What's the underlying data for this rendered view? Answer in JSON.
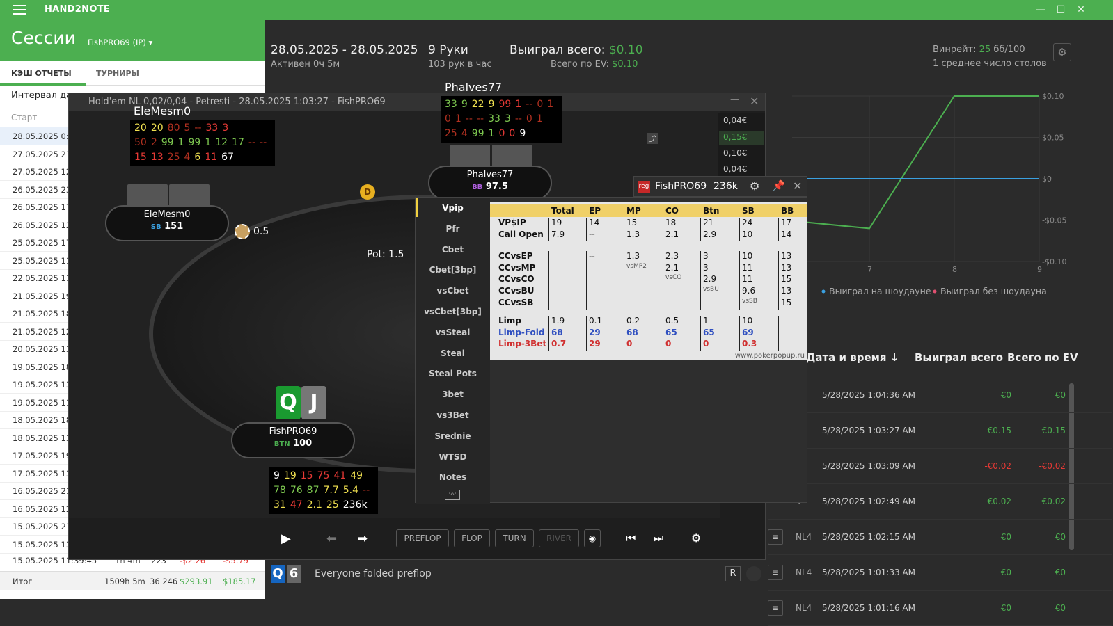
{
  "titlebar": {
    "app": "HAND2NOTE"
  },
  "header": {
    "title": "Сессии",
    "player": "FishPRO69 (IP)"
  },
  "tabs": {
    "cash": "КЭШ ОТЧЕТЫ",
    "tourn": "ТУРНИРЫ"
  },
  "left": {
    "interval": "Интервал да",
    "start": "Старт",
    "rows": [
      "28.05.2025 0:",
      "27.05.2025 21",
      "27.05.2025 12",
      "26.05.2025 23",
      "26.05.2025 17",
      "26.05.2025 12",
      "25.05.2025 17",
      "25.05.2025 11",
      "22.05.2025 11",
      "21.05.2025 19",
      "21.05.2025 18",
      "21.05.2025 12",
      "20.05.2025 13",
      "19.05.2025 18",
      "19.05.2025 13",
      "19.05.2025 11",
      "18.05.2025 18",
      "18.05.2025 13",
      "17.05.2025 19",
      "17.05.2025 13",
      "16.05.2025 21",
      "16.05.2025 12",
      "15.05.2025 21",
      "15.05.2025 13"
    ],
    "lastrow": {
      "date": "15.05.2025 11:39:45",
      "dur": "1h 4m",
      "hands": "223",
      "w": "-$2.26",
      "ev": "-$5.79"
    },
    "total": {
      "label": "Итог",
      "dur": "1509h 5m",
      "hands": "36 246",
      "w": "$293.91",
      "ev": "$185.17"
    }
  },
  "summary": {
    "dates": "28.05.2025 - 28.05.2025",
    "active": "Активен 0ч 5м",
    "hands": "9 Руки",
    "rate": "103 рук в час",
    "won_label": "Выиграл всего:",
    "won": "$0.10",
    "ev_label": "Всего по EV:",
    "ev": "$0.10",
    "winrate_label": "Винрейт:",
    "winrate_val": "25",
    "winrate_unit": "бб/100",
    "tables": "1 среднее число столов"
  },
  "chart_data": {
    "type": "line",
    "y_ticks": [
      "$0.10",
      "$0.05",
      "$0",
      "-$0.05",
      "-$0.10"
    ],
    "x_ticks": [
      "7",
      "8",
      "9"
    ],
    "legend": [
      "Выиграл на шоудауне",
      "Выиграл без шоудауна"
    ],
    "ylim": [
      -0.1,
      0.1
    ],
    "series": [
      {
        "name": "",
        "color": "#4caf50",
        "x": [
          6.0,
          7.0,
          8.0,
          9.0
        ],
        "y": [
          -0.05,
          -0.06,
          0.1,
          0.1
        ]
      },
      {
        "name": "",
        "color": "#3aa0e0",
        "x": [
          6.0,
          9.0
        ],
        "y": [
          0,
          0
        ]
      }
    ]
  },
  "table": {
    "headers": {
      "dt": "Дата и время",
      "won": "Выиграл всего",
      "ev": "Всего по EV"
    },
    "rows": [
      {
        "lim": "4",
        "dt": "5/28/2025 1:04:36 AM",
        "w": "€0",
        "ev": "€0",
        "c": "green"
      },
      {
        "lim": "4",
        "dt": "5/28/2025 1:03:27 AM",
        "w": "€0.15",
        "ev": "€0.15",
        "c": "green"
      },
      {
        "lim": "4",
        "dt": "5/28/2025 1:03:09 AM",
        "w": "-€0.02",
        "ev": "-€0.02",
        "c": "red"
      },
      {
        "lim": "4",
        "dt": "5/28/2025 1:02:49 AM",
        "w": "€0.02",
        "ev": "€0.02",
        "c": "green"
      },
      {
        "lim": "NL4",
        "dt": "5/28/2025 1:02:15 AM",
        "w": "€0",
        "ev": "€0",
        "c": "green"
      },
      {
        "lim": "NL4",
        "dt": "5/28/2025 1:01:33 AM",
        "w": "€0",
        "ev": "€0",
        "c": "green"
      },
      {
        "lim": "NL4",
        "dt": "5/28/2025 1:01:16 AM",
        "w": "€0",
        "ev": "€0",
        "c": "green"
      }
    ]
  },
  "replayer": {
    "title": "Hold'em NL 0,02/0,04 - Petresti - 28.05.2025 1:03:27 - FishPRO69",
    "pot": "Pot:  1.5",
    "bet_sb": "0.5",
    "bet_list": [
      "0,04€",
      "0,15€",
      "0,10€",
      "0,04€"
    ],
    "p1": {
      "name": "EleMesm0",
      "pos": "SB",
      "stack": "151"
    },
    "p2": {
      "name": "Phalves77",
      "pos": "BB",
      "stack": "97.5"
    },
    "p3": {
      "name": "FishPRO69",
      "pos": "BTN",
      "stack": "100"
    },
    "cards": [
      "Q",
      "J"
    ],
    "buttons": [
      "PREFLOP",
      "FLOP",
      "TURN",
      "RIVER"
    ],
    "bottom_text": "Everyone folded preflop",
    "bottom_cards": [
      "Q",
      "6"
    ],
    "r_label": "R",
    "dealer": "D"
  },
  "hud1": {
    "r1": [
      "20",
      "20",
      "80",
      "5",
      "--",
      "33",
      "3"
    ],
    "r2": [
      "50",
      "2",
      "99",
      "1",
      "99",
      "1",
      "12",
      "17",
      "--",
      "--"
    ],
    "r3": [
      "15",
      "13",
      "25",
      "4",
      "6",
      "11",
      "67"
    ]
  },
  "hud2": {
    "r1": [
      "33",
      "9",
      "22",
      "9",
      "99",
      "1",
      "--",
      "0",
      "1"
    ],
    "r2": [
      "0",
      "1",
      "--",
      "--",
      "33",
      "3",
      "--",
      "0",
      "1"
    ],
    "r3": [
      "25",
      "4",
      "99",
      "1",
      "0",
      "0",
      "9"
    ]
  },
  "hud3": {
    "r1": [
      "9",
      "19",
      "15",
      "75",
      "41",
      "49"
    ],
    "r2": [
      "78",
      "76",
      "87",
      "7.7",
      "5.4",
      "--"
    ],
    "r3": [
      "31",
      "47",
      "2.1",
      "25",
      "236k"
    ]
  },
  "popup": {
    "tag": "reg",
    "name": "FishPRO69",
    "hands": "236k",
    "menu": [
      "Vpip",
      "Pfr",
      "Cbet",
      "Cbet[3bp]",
      "vsCbet",
      "vsCbet[3bp]",
      "vsSteal",
      "Steal",
      "Steal Pots",
      "3bet",
      "vs3Bet",
      "Srednie",
      "WTSD",
      "Notes"
    ],
    "cols": [
      "Total",
      "EP",
      "MP",
      "CO",
      "Btn",
      "SB",
      "BB"
    ],
    "rows1": [
      [
        "VP$IP",
        "19",
        "14",
        "15",
        "18",
        "21",
        "24",
        "17"
      ],
      [
        "Call Open",
        "7.9",
        "--",
        "1.3",
        "2.1",
        "2.9",
        "10",
        "14"
      ]
    ],
    "rows2": [
      [
        "CCvsEP",
        "",
        "--",
        "1.3",
        "2.3",
        "3",
        "10",
        "13"
      ],
      [
        "CCvsMP",
        "",
        "",
        "vsMP2",
        "2.1",
        "3",
        "11",
        "13"
      ],
      [
        "CCvsCO",
        "",
        "",
        "",
        "vsCO",
        "2.9",
        "11",
        "15"
      ],
      [
        "CCvsBU",
        "",
        "",
        "",
        "",
        "vsBU",
        "9.6",
        "13"
      ],
      [
        "CCvsSB",
        "",
        "",
        "",
        "",
        "",
        "vsSB",
        "15"
      ]
    ],
    "rows3": [
      [
        "Limp",
        "1.9",
        "0.1",
        "0.2",
        "0.5",
        "1",
        "10",
        ""
      ],
      [
        "Limp-Fold",
        "68",
        "29",
        "68",
        "65",
        "65",
        "69",
        ""
      ],
      [
        "Limp-3Bet",
        "0.7",
        "29",
        "0",
        "0",
        "0",
        "0.3",
        ""
      ]
    ],
    "site": "www.pokerpopup.ru"
  }
}
